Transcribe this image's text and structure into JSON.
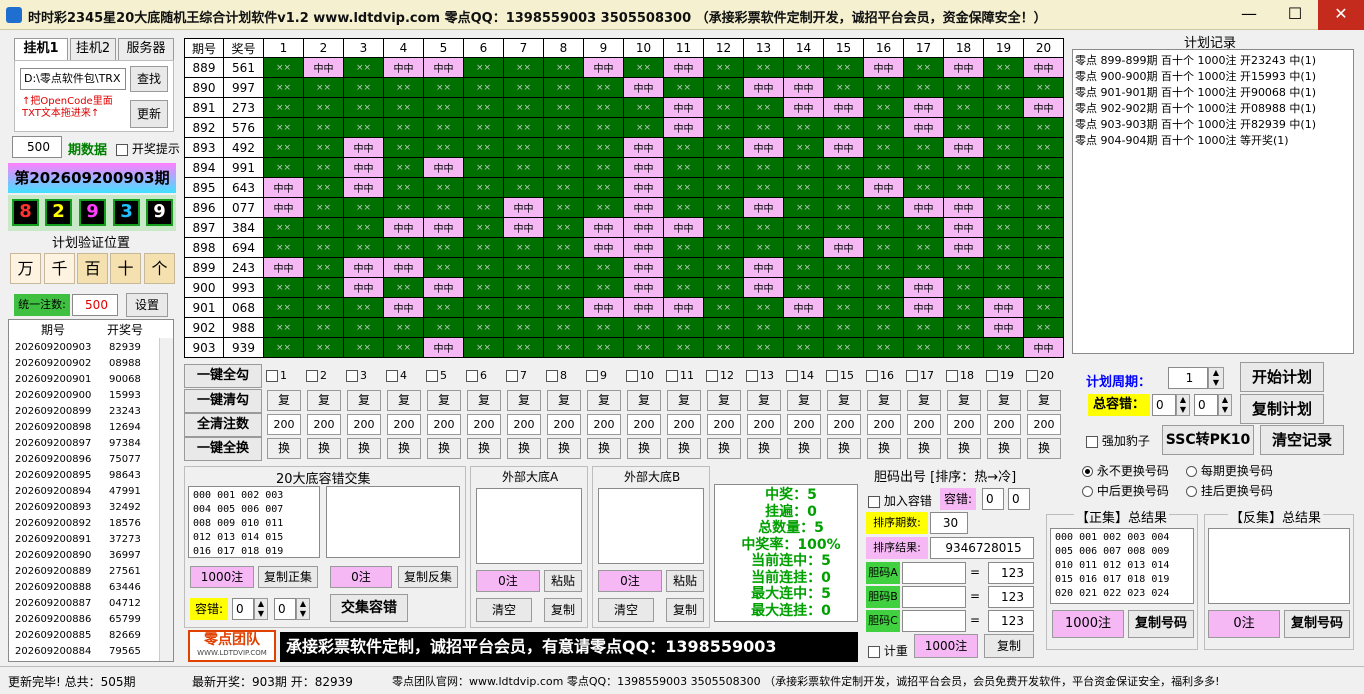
{
  "window": {
    "title": "时时彩2345星20大底随机王综合计划软件v1.2      www.ldtdvip.com      零点QQ：1398559003   3505508300  （承接彩票软件定制开发，诚招平台会员，资金保障安全！）",
    "minimize": "—",
    "maximize": "☐",
    "close": "✕"
  },
  "left": {
    "tabs": [
      "挂机1",
      "挂机2",
      "服务器"
    ],
    "path": "D:\\零点软件包\\TRX",
    "find_btn": "查找",
    "update_btn": "更新",
    "hint": "↑把OpenCode里面\nTXT文本拖进来↑",
    "period_count": "500",
    "period_label": "期数据",
    "prize_hint": "开奖提示",
    "current_issue": "第202609200903期",
    "digits": [
      {
        "v": "8",
        "c": "#ff3030"
      },
      {
        "v": "2",
        "c": "#ffff00"
      },
      {
        "v": "9",
        "c": "#ff40ff"
      },
      {
        "v": "3",
        "c": "#20c0ff"
      },
      {
        "v": "9",
        "c": "#ffffff"
      }
    ],
    "verify_label": "计划验证位置",
    "positions": [
      "万",
      "千",
      "百",
      "十",
      "个"
    ],
    "uniform_label": "统一注数:",
    "uniform_value": "500",
    "settings_btn": "设置",
    "hist_header": [
      "期号",
      "开奖号"
    ],
    "history": [
      [
        "202609200903",
        "82939"
      ],
      [
        "202609200902",
        "08988"
      ],
      [
        "202609200901",
        "90068"
      ],
      [
        "202609200900",
        "15993"
      ],
      [
        "202609200899",
        "23243"
      ],
      [
        "202609200898",
        "12694"
      ],
      [
        "202609200897",
        "97384"
      ],
      [
        "202609200896",
        "75077"
      ],
      [
        "202609200895",
        "98643"
      ],
      [
        "202609200894",
        "47991"
      ],
      [
        "202609200893",
        "32492"
      ],
      [
        "202609200892",
        "18576"
      ],
      [
        "202609200891",
        "37273"
      ],
      [
        "202609200890",
        "36997"
      ],
      [
        "202609200889",
        "27561"
      ],
      [
        "202609200888",
        "63446"
      ],
      [
        "202609200887",
        "04712"
      ],
      [
        "202609200886",
        "65799"
      ],
      [
        "202609200885",
        "82669"
      ],
      [
        "202609200884",
        "79565"
      ]
    ]
  },
  "grid": {
    "headers": [
      "期号",
      "奖号",
      "1",
      "2",
      "3",
      "4",
      "5",
      "6",
      "7",
      "8",
      "9",
      "10",
      "11",
      "12",
      "13",
      "14",
      "15",
      "16",
      "17",
      "18",
      "19",
      "20"
    ],
    "miss": "××",
    "hit": "中中",
    "rows": [
      {
        "p": "889",
        "n": "561",
        "h": [
          2,
          4,
          5,
          9,
          11,
          16,
          18,
          20
        ]
      },
      {
        "p": "890",
        "n": "997",
        "h": [
          10,
          13,
          14
        ]
      },
      {
        "p": "891",
        "n": "273",
        "h": [
          11,
          14,
          15,
          17,
          20
        ]
      },
      {
        "p": "892",
        "n": "576",
        "h": [
          11,
          17
        ]
      },
      {
        "p": "893",
        "n": "492",
        "h": [
          3,
          10,
          13,
          15,
          18
        ]
      },
      {
        "p": "894",
        "n": "991",
        "h": [
          3,
          5,
          10
        ]
      },
      {
        "p": "895",
        "n": "643",
        "h": [
          1,
          3,
          10,
          16
        ]
      },
      {
        "p": "896",
        "n": "077",
        "h": [
          1,
          7,
          10,
          13,
          17,
          18
        ]
      },
      {
        "p": "897",
        "n": "384",
        "h": [
          4,
          5,
          7,
          9,
          10,
          11,
          18
        ]
      },
      {
        "p": "898",
        "n": "694",
        "h": [
          9,
          10,
          15,
          18
        ]
      },
      {
        "p": "899",
        "n": "243",
        "h": [
          1,
          3,
          4,
          10,
          13
        ]
      },
      {
        "p": "900",
        "n": "993",
        "h": [
          3,
          5,
          10,
          13,
          17
        ]
      },
      {
        "p": "901",
        "n": "068",
        "h": [
          4,
          9,
          10,
          11,
          14,
          17,
          19
        ]
      },
      {
        "p": "902",
        "n": "988",
        "h": [
          19
        ]
      },
      {
        "p": "903",
        "n": "939",
        "h": [
          5,
          20
        ]
      }
    ]
  },
  "controls": {
    "check_all": "一键全勾",
    "clear_all": "一键清勾",
    "reset_all": "全清注数",
    "swap_all": "一键全换",
    "col_nums": [
      "1",
      "2",
      "3",
      "4",
      "5",
      "6",
      "7",
      "8",
      "9",
      "10",
      "11",
      "12",
      "13",
      "14",
      "15",
      "16",
      "17",
      "18",
      "19",
      "20"
    ],
    "fu": "复",
    "zhuan": "200",
    "huan": "换"
  },
  "plan": {
    "title": "计划记录",
    "records": [
      "零点 899-899期 百十个 1000注  开23243 中(1)",
      "零点 900-900期 百十个 1000注  开15993 中(1)",
      "零点 901-901期 百十个 1000注  开90068 中(1)",
      "零点 902-902期 百十个 1000注  开08988 中(1)",
      "零点 903-903期 百十个 1000注  开82939 中(1)",
      "零点 904-904期 百十个 1000注  等开奖(1)"
    ],
    "cycle_label": "计划周期：",
    "cycle_value": "1",
    "start_btn": "开始计划",
    "tolerance_label": "总容错：",
    "tol_a": "0",
    "tol_b": "0",
    "copy_btn": "复制计划",
    "force_label": "强加豹子",
    "pk_btn": "SSC转PK10",
    "clear_btn": "清空记录",
    "radios": [
      "永不更换号码",
      "每期更换号码",
      "中后更换号码",
      "挂后更换号码"
    ]
  },
  "bottom": {
    "intersect_title": "20大底容错交集",
    "intersect_text": "000 001 002 003\n004 005 006 007\n008 009 010 011\n012 013 014 015\n016 017 018 019",
    "count_1000": "1000注",
    "copy_pos": "复制正集",
    "count_0": "0注",
    "copy_neg": "复制反集",
    "tol_label": "容错:",
    "tol_a": "0",
    "tol_b": "0",
    "inter_btn": "交集容错",
    "ext_a": "外部大底A",
    "ext_b": "外部大底B",
    "paste": "粘贴",
    "clear": "清空",
    "copy": "复制",
    "stats": [
      "中奖：5",
      "挂遍：0",
      "总数量：5",
      "中奖率：100%",
      "当前连中：5",
      "当前连挂：0",
      "最大连中：5",
      "最大连挂：0"
    ],
    "logo_text": "零点团队",
    "logo_sub": "WWW.LDTDVIP.COM",
    "banner": "承接彩票软件定制，诚招平台会员，有意请零点QQ：1398559003",
    "gall_title": "胆码出号 [排序：热→冷]",
    "add_tol": "加入容错",
    "tol2_label": "容错:",
    "tol2_a": "0",
    "tol2_b": "0",
    "sort_periods_label": "排序期数:",
    "sort_periods": "30",
    "sort_result_label": "排序结果:",
    "sort_result": "9346728015",
    "gall_rows": [
      {
        "l": "胆码A",
        "v": "123"
      },
      {
        "l": "胆码B",
        "v": "123"
      },
      {
        "l": "胆码C",
        "v": "123"
      }
    ],
    "eq": "=",
    "jizhong": "计重",
    "gall_count": "1000注",
    "gall_copy": "复制",
    "pos_title": "【正集】总结果",
    "pos_text": "000 001 002 003 004\n005 006 007 008 009\n010 011 012 013 014\n015 016 017 018 019\n020 021 022 023 024",
    "pos_count": "1000注",
    "pos_copy": "复制号码",
    "neg_title": "【反集】总结果",
    "neg_count": "0注",
    "neg_copy": "复制号码"
  },
  "status": {
    "s1": "更新完毕! 总共：505期",
    "s2": "最新开奖：903期 开：82939",
    "s3": "零点团队官网：www.ldtdvip.com    零点QQ：1398559003   3505508300  （承接彩票软件定制开发，诚招平台会员，会员免费开发软件，平台资金保证安全，福利多多!"
  }
}
